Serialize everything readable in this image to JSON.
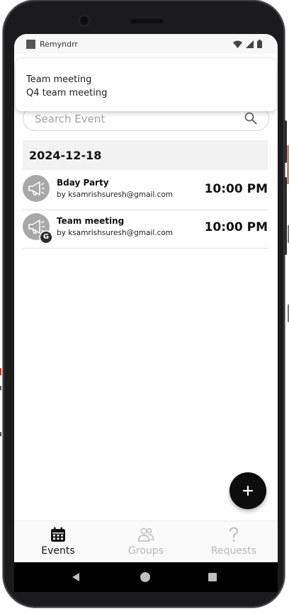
{
  "status_bar": {
    "app_name": "Remyndrr"
  },
  "notification": {
    "title": "Team meeting",
    "body": "Q4 team meeting"
  },
  "search": {
    "placeholder": "Search Event"
  },
  "date_group": "2024-12-18",
  "events": [
    {
      "title": "Bday Party",
      "by": "by ksamrishsuresh@gmail.com",
      "time": "10:00 PM",
      "group_badge": ""
    },
    {
      "title": "Team meeting",
      "by": "by ksamrishsuresh@gmail.com",
      "time": "10:00 PM",
      "group_badge": "G"
    }
  ],
  "fab": {
    "icon": "plus-icon"
  },
  "bottom_nav": [
    {
      "label": "Events",
      "icon": "calendar-icon",
      "active": true
    },
    {
      "label": "Groups",
      "icon": "people-icon",
      "active": false
    },
    {
      "label": "Requests",
      "icon": "question-mark-icon",
      "active": false
    }
  ],
  "colors": {
    "accent": "#111111",
    "inactive": "#b8b8b8",
    "avatar_bg": "#a8a8a8"
  }
}
